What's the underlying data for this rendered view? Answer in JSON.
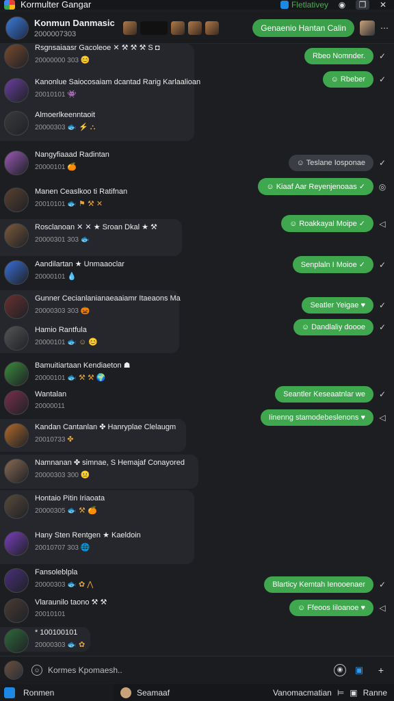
{
  "titlebar": {
    "title": "Kormulter Gangar",
    "status": "Fletlativey",
    "icons": [
      "app-logo-icon",
      "status-icon",
      "clock-icon",
      "window-icon",
      "close-icon"
    ]
  },
  "header": {
    "name": "Konmun Danmasic",
    "subtitle": "2000007303",
    "pill": "Genaenio Hantan Calin",
    "more": "⋯"
  },
  "left_messages": [
    {
      "name": "Rsgnsaiaasr Gacoleoe ✕ ⚒ ⚒ ⚒ S ◘",
      "meta": "20000000 303",
      "reacts": "😊"
    },
    {
      "name": "Kanonlue Saiocosaiam dcantad Rarig Karlaalioan",
      "meta": "20010101",
      "reacts": "👾"
    },
    {
      "name": "Almoerlkeenntaoit",
      "meta": "20000303",
      "reacts": "🐟 ⚡ ⛬"
    },
    {
      "name": "Nangyfiaaad Radintan",
      "meta": "20000101",
      "reacts": "🍊"
    },
    {
      "name": "Manen Ceaslkoo ti Ratifnan",
      "meta": "20010101",
      "reacts": "🐟 ⚑ ⚒ ✕"
    },
    {
      "name": "Rosclanoan ✕ ✕ ★ Sroan Dkal ★ ⚒",
      "meta": "20000301 303",
      "reacts": "🐟"
    },
    {
      "name": "Aandilartan ★ Unmaaoclar",
      "meta": "20000101",
      "reacts": "💧"
    },
    {
      "name": "Gunner Cecianlanianaeaaiamr Itaeaons Ma",
      "meta": "20000303 303",
      "reacts": "🎃"
    },
    {
      "name": "Hamio Rantfula",
      "meta": "20000101",
      "reacts": "🐟 ☺ 😊"
    },
    {
      "name": "Bamuitiartaan Kendiaeton ☗",
      "meta": "20000101",
      "reacts": "🐟 ⚒ ⚒ 🌍"
    },
    {
      "name": "Wantalan",
      "meta": "20000011",
      "reacts": ""
    },
    {
      "name": "Kandan Cantanlan ✤ Hanryplae Clelaugm",
      "meta": "20010733",
      "reacts": "✤"
    },
    {
      "name": "Namnanan ✤ simnae, S Hemajaf Conayored",
      "meta": "20000303 300",
      "reacts": "😐"
    },
    {
      "name": "Hontaio Pitin Iriaoata",
      "meta": "20000305",
      "reacts": "🐟 ⚒ 🍊"
    },
    {
      "name": "Hany Sten Rentgen ★ Kaeldoin",
      "meta": "20010707 303",
      "reacts": "🌐"
    },
    {
      "name": "Fansoleblpla",
      "meta": "20000303",
      "reacts": "🐟 ✿ ⋀"
    },
    {
      "name": "Vlaraunilo taono ⚒ ⚒",
      "meta": "20010101",
      "reacts": ""
    },
    {
      "name": "* 100100101",
      "meta": "20000303",
      "reacts": "🐟 ✿"
    }
  ],
  "right_messages": [
    {
      "text": "Rbeo Nomnder.",
      "tick": "✓",
      "style": "green"
    },
    {
      "text": "☺ Rbeber",
      "tick": "✓",
      "style": "green"
    },
    {
      "text": "☺ Teslane Iosponae",
      "tick": "✓",
      "style": "gray"
    },
    {
      "text": "☺ Kiaaf Aar Reyenjenoaas ✓",
      "tick": "◎",
      "style": "green"
    },
    {
      "text": "☺ Roakkayal Moipe ✓",
      "tick": "◁",
      "style": "green"
    },
    {
      "text": "Senplaln I Moioe ✓",
      "tick": "✓",
      "style": "green"
    },
    {
      "text": "Seatler Yeigae ♥",
      "tick": "✓",
      "style": "green"
    },
    {
      "text": "☺ Dandlaliy doooe",
      "tick": "✓",
      "style": "green"
    },
    {
      "text": "Seantler Keseaatnlar we",
      "tick": "✓",
      "style": "green"
    },
    {
      "text": "Iinenng stamodebeslenons ♥",
      "tick": "◁",
      "style": "green"
    },
    {
      "text": "Blarticy Kemtah Ienooenaer",
      "tick": "✓",
      "style": "green"
    },
    {
      "text": "☺ Ffeoos Iiloanoe ♥",
      "tick": "◁",
      "style": "green"
    }
  ],
  "composer": {
    "placeholder": "Kormes Kpomaesh.."
  },
  "bottombar": {
    "left": "Ronmen",
    "mid": "Seamaaf",
    "right": "Vanomacmatian",
    "right2": "Ranne"
  }
}
